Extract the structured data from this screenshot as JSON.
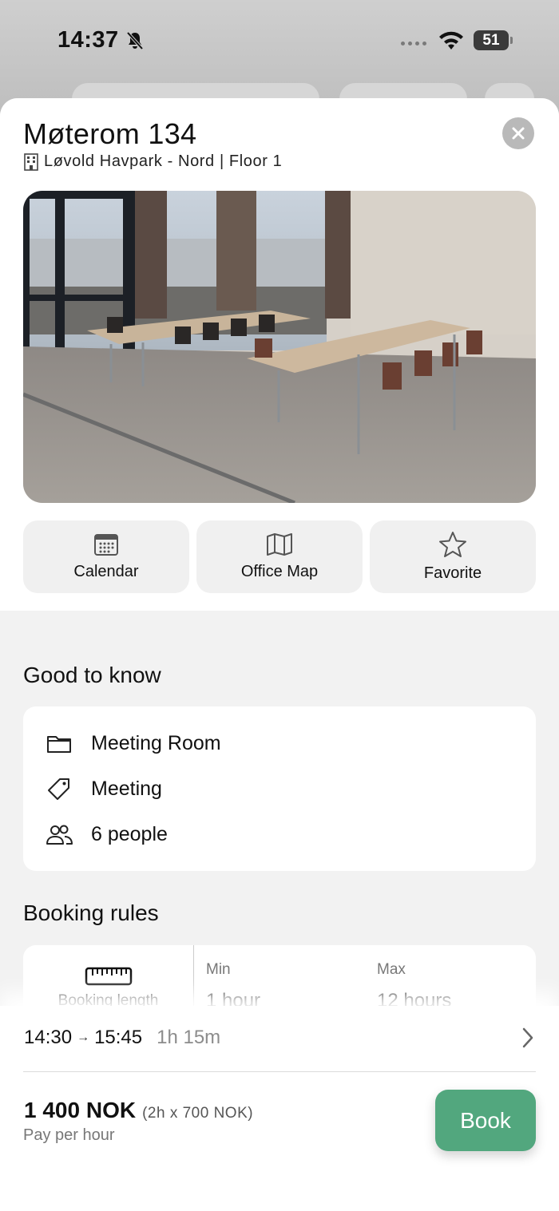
{
  "status_bar": {
    "time": "14:37",
    "battery": "51"
  },
  "room": {
    "title": "Møterom 134",
    "location": "Løvold Havpark - Nord | Floor 1"
  },
  "actions": [
    {
      "label": "Calendar",
      "icon": "calendar-icon"
    },
    {
      "label": "Office Map",
      "icon": "map-icon"
    },
    {
      "label": "Favorite",
      "icon": "star-icon"
    }
  ],
  "good_to_know": {
    "title": "Good to know",
    "items": [
      {
        "icon": "folder-icon",
        "text": "Meeting Room"
      },
      {
        "icon": "tag-icon",
        "text": "Meeting"
      },
      {
        "icon": "people-icon",
        "text": "6 people"
      }
    ]
  },
  "booking_rules": {
    "title": "Booking rules",
    "rule_label": "Booking length",
    "min_header": "Min",
    "min_value": "1 hour",
    "max_header": "Max",
    "max_value": "12 hours"
  },
  "booking": {
    "time_from": "14:30",
    "time_to": "15:45",
    "duration": "1h 15m",
    "price": "1 400 NOK",
    "price_detail": "(2h x 700 NOK)",
    "price_sub": "Pay per hour",
    "book_label": "Book"
  },
  "colors": {
    "accent": "#52a77e",
    "sheet_bg": "#f2f2f2"
  }
}
